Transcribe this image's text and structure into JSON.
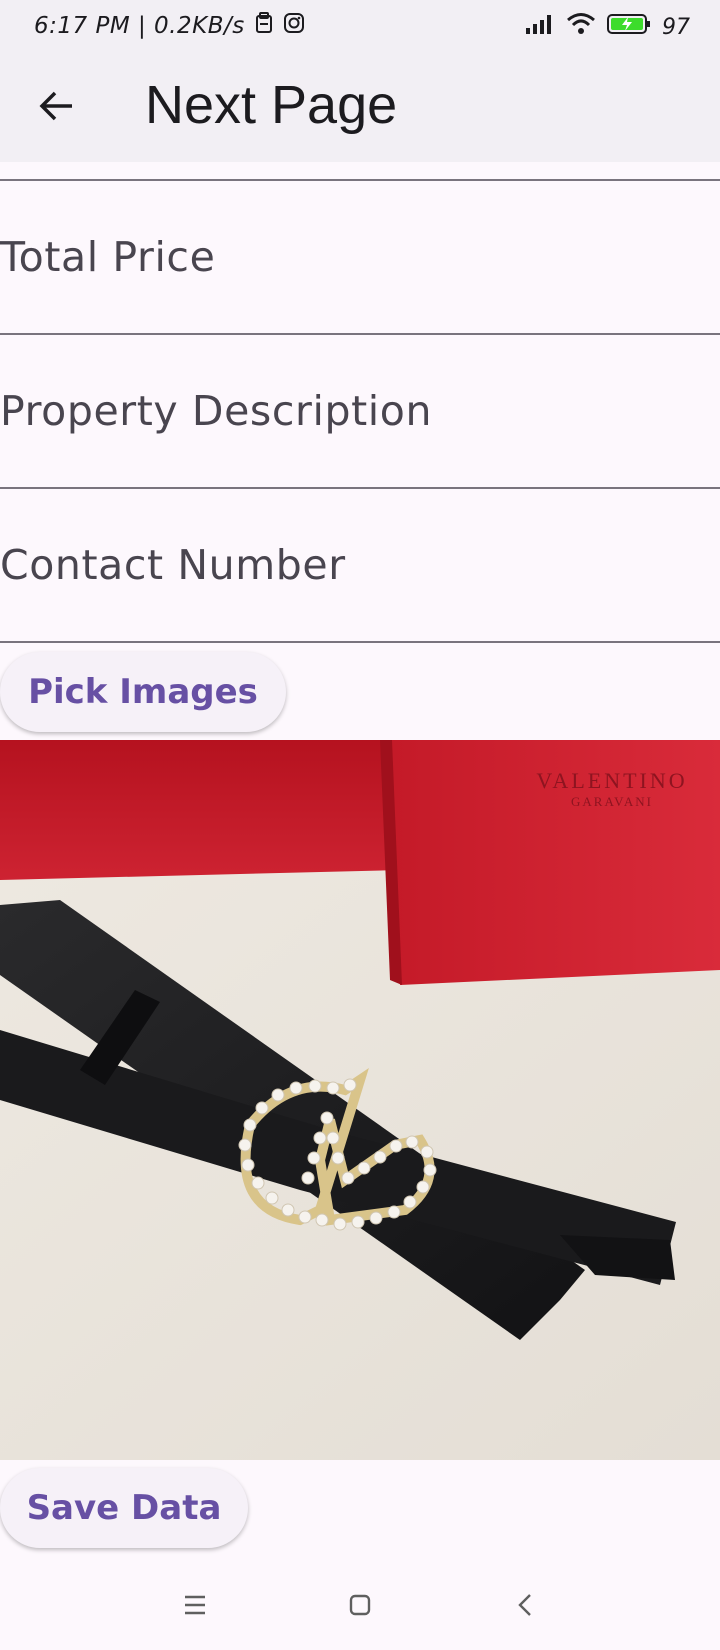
{
  "status_bar": {
    "time_speed": "6:17 PM | 0.2KB/s",
    "battery": "97"
  },
  "app_bar": {
    "title": "Next Page"
  },
  "form": {
    "fields": [
      {
        "label": "Total Price"
      },
      {
        "label": "Property Description"
      },
      {
        "label": "Contact Number"
      }
    ],
    "pick_images_label": "Pick Images",
    "save_data_label": "Save Data"
  },
  "image": {
    "box_text_line1": "VALENTINO",
    "box_text_line2": "GARAVANI"
  },
  "colors": {
    "accent": "#6750a4",
    "surface": "#fdf8fd",
    "app_bar": "#f2eff4",
    "divider": "#79747e",
    "battery": "#3ddc2b"
  },
  "icons": {
    "back": "arrow-left-icon",
    "nav_menu": "menu-icon",
    "nav_home": "home-square-icon",
    "nav_back": "chevron-left-icon"
  }
}
